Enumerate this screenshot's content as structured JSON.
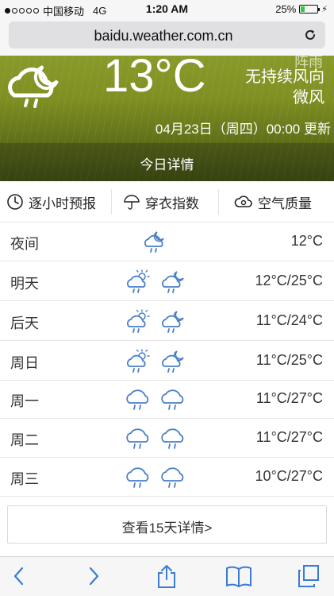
{
  "status": {
    "carrier": "中国移动",
    "network": "4G",
    "time": "1:20 AM",
    "battery": "25%",
    "battery_level": 0.25,
    "signal_bars": 1
  },
  "browser": {
    "url": "baidu.weather.com.cn"
  },
  "current": {
    "temperature": "13°C",
    "wind_partial": "阵雨",
    "wind": "无持续风向",
    "wind_level": "微风",
    "updated": "04月23日（周四）00:00 更新",
    "today_detail": "今日详情",
    "icon": "cloud-rain-night-icon"
  },
  "tabs": [
    {
      "label": "逐小时预报",
      "icon": "clock-icon"
    },
    {
      "label": "穿衣指数",
      "icon": "umbrella-icon"
    },
    {
      "label": "空气质量",
      "icon": "cloud-icon"
    }
  ],
  "forecast": [
    {
      "day": "夜间",
      "temps": "12°C",
      "icons": [
        "cloud-rain-night-icon"
      ]
    },
    {
      "day": "明天",
      "temps": "12°C/25°C",
      "icons": [
        "sun-cloud-rain-icon",
        "moon-cloud-rain-icon"
      ]
    },
    {
      "day": "后天",
      "temps": "11°C/24°C",
      "icons": [
        "sun-cloud-rain-icon",
        "moon-cloud-rain-icon"
      ]
    },
    {
      "day": "周日",
      "temps": "11°C/25°C",
      "icons": [
        "sun-cloud-rain-icon",
        "moon-cloud-rain-icon"
      ]
    },
    {
      "day": "周一",
      "temps": "11°C/27°C",
      "icons": [
        "cloud-rain-icon",
        "cloud-rain-icon"
      ]
    },
    {
      "day": "周二",
      "temps": "11°C/27°C",
      "icons": [
        "cloud-rain-icon",
        "cloud-rain-icon"
      ]
    },
    {
      "day": "周三",
      "temps": "10°C/27°C",
      "icons": [
        "cloud-rain-icon",
        "cloud-rain-icon"
      ]
    }
  ],
  "more_button": "查看15天详情>",
  "colors": {
    "accent": "#3b7bd4",
    "icon_blue": "#4a7fc8",
    "hero_green": "#7f8f22"
  }
}
